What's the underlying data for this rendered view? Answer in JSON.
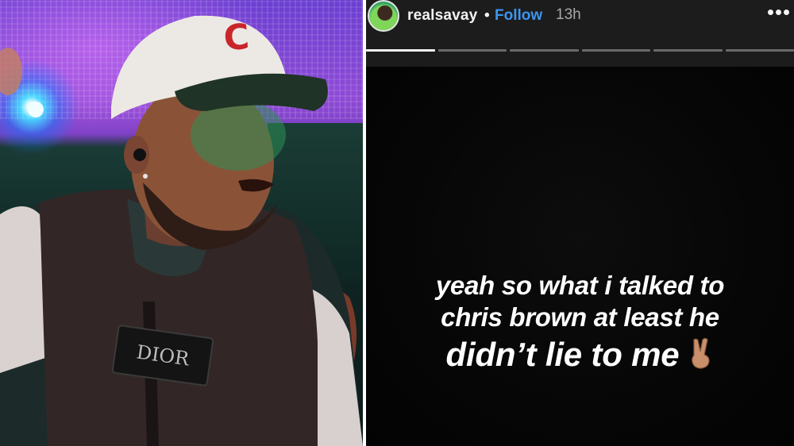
{
  "story": {
    "username": "realsavay",
    "separator": "•",
    "follow_label": "Follow",
    "timestamp": "13h",
    "segments": 6,
    "active_segment": 1,
    "caption": {
      "line1": "yeah so what i talked to",
      "line2": "chris brown at least he",
      "line3": "didn’t lie to me"
    },
    "emoji": "victory-hand-emoji"
  },
  "photo": {
    "cap_letter": "C",
    "vest_patch": "DIOR"
  },
  "colors": {
    "follow": "#3d95f0",
    "header_bg": "#1c1c1c",
    "story_bg": "#050505",
    "progress_active": "#f2f2f2",
    "progress_inactive": "#6a6a6a"
  }
}
